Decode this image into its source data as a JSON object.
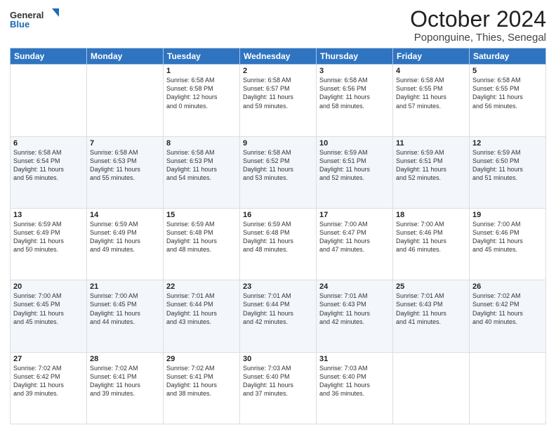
{
  "logo": {
    "line1": "General",
    "line2": "Blue"
  },
  "header": {
    "month": "October 2024",
    "location": "Poponguine, Thies, Senegal"
  },
  "weekdays": [
    "Sunday",
    "Monday",
    "Tuesday",
    "Wednesday",
    "Thursday",
    "Friday",
    "Saturday"
  ],
  "weeks": [
    [
      {
        "day": "",
        "detail": ""
      },
      {
        "day": "",
        "detail": ""
      },
      {
        "day": "1",
        "detail": "Sunrise: 6:58 AM\nSunset: 6:58 PM\nDaylight: 12 hours\nand 0 minutes."
      },
      {
        "day": "2",
        "detail": "Sunrise: 6:58 AM\nSunset: 6:57 PM\nDaylight: 11 hours\nand 59 minutes."
      },
      {
        "day": "3",
        "detail": "Sunrise: 6:58 AM\nSunset: 6:56 PM\nDaylight: 11 hours\nand 58 minutes."
      },
      {
        "day": "4",
        "detail": "Sunrise: 6:58 AM\nSunset: 6:55 PM\nDaylight: 11 hours\nand 57 minutes."
      },
      {
        "day": "5",
        "detail": "Sunrise: 6:58 AM\nSunset: 6:55 PM\nDaylight: 11 hours\nand 56 minutes."
      }
    ],
    [
      {
        "day": "6",
        "detail": "Sunrise: 6:58 AM\nSunset: 6:54 PM\nDaylight: 11 hours\nand 56 minutes."
      },
      {
        "day": "7",
        "detail": "Sunrise: 6:58 AM\nSunset: 6:53 PM\nDaylight: 11 hours\nand 55 minutes."
      },
      {
        "day": "8",
        "detail": "Sunrise: 6:58 AM\nSunset: 6:53 PM\nDaylight: 11 hours\nand 54 minutes."
      },
      {
        "day": "9",
        "detail": "Sunrise: 6:58 AM\nSunset: 6:52 PM\nDaylight: 11 hours\nand 53 minutes."
      },
      {
        "day": "10",
        "detail": "Sunrise: 6:59 AM\nSunset: 6:51 PM\nDaylight: 11 hours\nand 52 minutes."
      },
      {
        "day": "11",
        "detail": "Sunrise: 6:59 AM\nSunset: 6:51 PM\nDaylight: 11 hours\nand 52 minutes."
      },
      {
        "day": "12",
        "detail": "Sunrise: 6:59 AM\nSunset: 6:50 PM\nDaylight: 11 hours\nand 51 minutes."
      }
    ],
    [
      {
        "day": "13",
        "detail": "Sunrise: 6:59 AM\nSunset: 6:49 PM\nDaylight: 11 hours\nand 50 minutes."
      },
      {
        "day": "14",
        "detail": "Sunrise: 6:59 AM\nSunset: 6:49 PM\nDaylight: 11 hours\nand 49 minutes."
      },
      {
        "day": "15",
        "detail": "Sunrise: 6:59 AM\nSunset: 6:48 PM\nDaylight: 11 hours\nand 48 minutes."
      },
      {
        "day": "16",
        "detail": "Sunrise: 6:59 AM\nSunset: 6:48 PM\nDaylight: 11 hours\nand 48 minutes."
      },
      {
        "day": "17",
        "detail": "Sunrise: 7:00 AM\nSunset: 6:47 PM\nDaylight: 11 hours\nand 47 minutes."
      },
      {
        "day": "18",
        "detail": "Sunrise: 7:00 AM\nSunset: 6:46 PM\nDaylight: 11 hours\nand 46 minutes."
      },
      {
        "day": "19",
        "detail": "Sunrise: 7:00 AM\nSunset: 6:46 PM\nDaylight: 11 hours\nand 45 minutes."
      }
    ],
    [
      {
        "day": "20",
        "detail": "Sunrise: 7:00 AM\nSunset: 6:45 PM\nDaylight: 11 hours\nand 45 minutes."
      },
      {
        "day": "21",
        "detail": "Sunrise: 7:00 AM\nSunset: 6:45 PM\nDaylight: 11 hours\nand 44 minutes."
      },
      {
        "day": "22",
        "detail": "Sunrise: 7:01 AM\nSunset: 6:44 PM\nDaylight: 11 hours\nand 43 minutes."
      },
      {
        "day": "23",
        "detail": "Sunrise: 7:01 AM\nSunset: 6:44 PM\nDaylight: 11 hours\nand 42 minutes."
      },
      {
        "day": "24",
        "detail": "Sunrise: 7:01 AM\nSunset: 6:43 PM\nDaylight: 11 hours\nand 42 minutes."
      },
      {
        "day": "25",
        "detail": "Sunrise: 7:01 AM\nSunset: 6:43 PM\nDaylight: 11 hours\nand 41 minutes."
      },
      {
        "day": "26",
        "detail": "Sunrise: 7:02 AM\nSunset: 6:42 PM\nDaylight: 11 hours\nand 40 minutes."
      }
    ],
    [
      {
        "day": "27",
        "detail": "Sunrise: 7:02 AM\nSunset: 6:42 PM\nDaylight: 11 hours\nand 39 minutes."
      },
      {
        "day": "28",
        "detail": "Sunrise: 7:02 AM\nSunset: 6:41 PM\nDaylight: 11 hours\nand 39 minutes."
      },
      {
        "day": "29",
        "detail": "Sunrise: 7:02 AM\nSunset: 6:41 PM\nDaylight: 11 hours\nand 38 minutes."
      },
      {
        "day": "30",
        "detail": "Sunrise: 7:03 AM\nSunset: 6:40 PM\nDaylight: 11 hours\nand 37 minutes."
      },
      {
        "day": "31",
        "detail": "Sunrise: 7:03 AM\nSunset: 6:40 PM\nDaylight: 11 hours\nand 36 minutes."
      },
      {
        "day": "",
        "detail": ""
      },
      {
        "day": "",
        "detail": ""
      }
    ]
  ]
}
